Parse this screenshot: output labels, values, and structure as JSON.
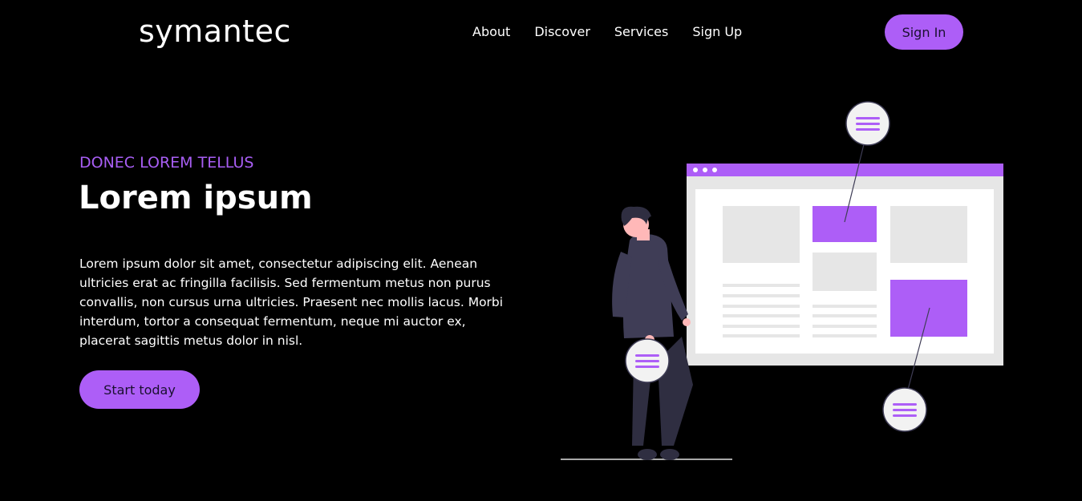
{
  "header": {
    "logo": "symantec",
    "nav": [
      "About",
      "Discover",
      "Services",
      "Sign Up"
    ],
    "signin_label": "Sign In"
  },
  "hero": {
    "eyebrow": "DONEC LOREM TELLUS",
    "title": "Lorem ipsum",
    "description": "Lorem ipsum dolor sit amet, consectetur adipiscing elit. Aenean ultricies erat ac fringilla facilisis. Sed fermentum metus non purus convallis, non cursus urna ultricies. Praesent nec mollis lacus. Morbi interdum, tortor a consequat fermentum, neque mi auctor ex, placerat sagittis metus dolor in nisl.",
    "cta_label": "Start today"
  },
  "colors": {
    "background": "#000000",
    "accent": "#ad5ef7",
    "text": "#ffffff"
  },
  "illustration": {
    "name": "person-with-browser-illustration"
  }
}
